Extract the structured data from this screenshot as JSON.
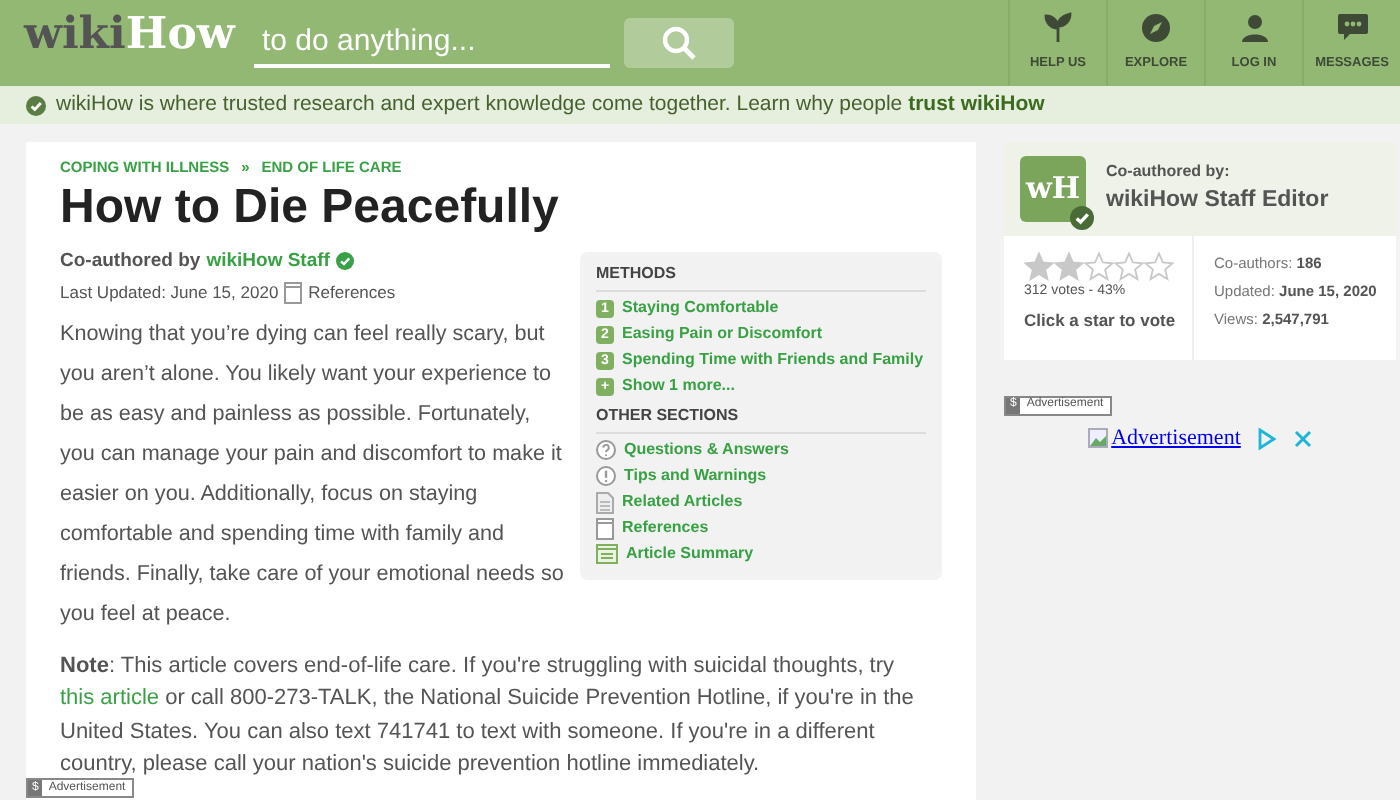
{
  "header": {
    "logo": [
      "wiki",
      "How"
    ],
    "search": {
      "placeholder": "to do anything..."
    },
    "nav": [
      {
        "label": "HELP US"
      },
      {
        "label": "EXPLORE"
      },
      {
        "label": "LOG IN"
      },
      {
        "label": "MESSAGES"
      }
    ]
  },
  "trust_bar": {
    "text": "wikiHow is where trusted research and expert knowledge come together. Learn why people **trust wikiHow**"
  },
  "article": {
    "breadcrumbs": [
      "COPING WITH ILLNESS",
      "»",
      "END OF LIFE CARE"
    ],
    "title": "How to Die Peacefully",
    "byline": {
      "prefix": "Co-authored by",
      "author": "wikiHow Staff"
    },
    "updated": "Last Updated: June 15, 2020",
    "references": "References",
    "toc": {
      "sections": [
        {
          "heading": "METHODS",
          "items": [
            {
              "kind": "number",
              "badge": "1",
              "label": "Staying Comfortable"
            },
            {
              "kind": "number",
              "badge": "2",
              "label": "Easing Pain or Discomfort"
            },
            {
              "kind": "number",
              "badge": "3",
              "label": "Spending Time with Friends and Family"
            },
            {
              "kind": "number",
              "badge": "+",
              "label": "Show 1 more..."
            }
          ]
        },
        {
          "heading": "OTHER SECTIONS",
          "items": [
            {
              "kind": "question",
              "label": "Questions & Answers"
            },
            {
              "kind": "warning",
              "label": "Tips and Warnings"
            },
            {
              "kind": "document",
              "label": "Related Articles"
            },
            {
              "kind": "notepad",
              "label": "References"
            },
            {
              "kind": "summary",
              "label": "Article Summary"
            }
          ]
        }
      ]
    },
    "intro": "Knowing that you’re dying can feel really scary, but you aren’t alone. You likely want your experience to be as easy and painless as possible. Fortunately, you can manage your pain and discomfort to make it easier on you. Additionally, focus on staying comfortable and spending time with family and friends. Finally, take care of your emotional needs so you feel at peace.",
    "note": {
      "label": "Note",
      "before": ": This article covers end-of-life care. If you're struggling with suicidal thoughts, try ",
      "link": "this article",
      "after": " or call 800-273-TALK, the National Suicide Prevention Hotline, if you're in the United States. You can also text 741741 to text with someone. If you're in a different country, please call your nation's suicide prevention hotline immediately."
    },
    "ad_label": {
      "symbol": "$",
      "text": "Advertisement"
    }
  },
  "sidebar": {
    "author": {
      "label": "Co-authored by:",
      "name": "wikiHow Staff Editor",
      "avatar": "wH"
    },
    "rating": {
      "stars": 2,
      "votes": "312 votes - 43%",
      "cta": "Click a star to vote"
    },
    "stats": [
      {
        "label": "Co-authors:",
        "value": "186"
      },
      {
        "label": "Updated:",
        "value": "June 15, 2020"
      },
      {
        "label": "Views:",
        "value": "2,547,791"
      }
    ],
    "ad_label": {
      "symbol": "$",
      "text": "Advertisement"
    },
    "ad": {
      "text": "Advertisement"
    }
  }
}
